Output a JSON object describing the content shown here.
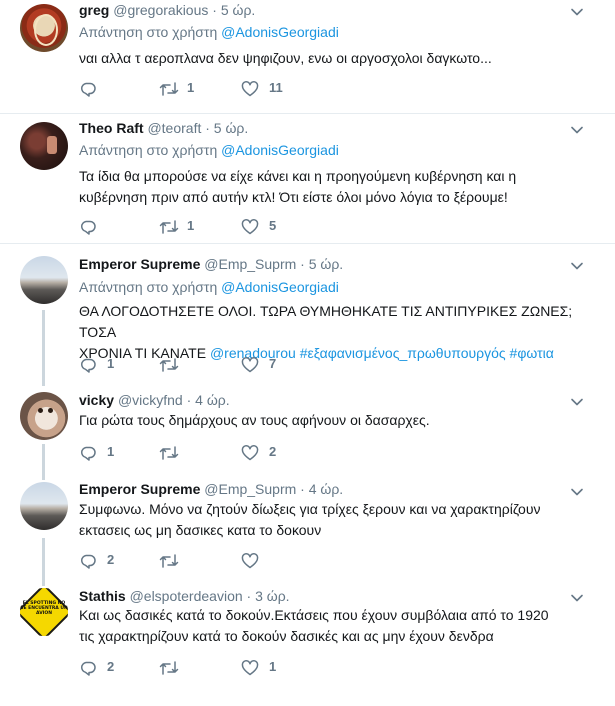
{
  "tweets": [
    {
      "name": "greg",
      "handle": "@gregorakious",
      "time": " · 5 ώρ.",
      "reply_prefix": "Απάντηση στο χρήστη ",
      "reply_mention": "@AdonisGeorgiadi",
      "text": "ναι αλλα τ αεροπλανα δεν ψηφιζουν, ενω οι αργοσχολοι δαγκωτο...",
      "replies": "",
      "retweets": "1",
      "likes": "11"
    },
    {
      "name": "Theo Raft",
      "handle": "@teoraft",
      "time": " · 5 ώρ.",
      "reply_prefix": "Απάντηση στο χρήστη ",
      "reply_mention": "@AdonisGeorgiadi",
      "text_lines": [
        "Τα ίδια θα μπορούσε να είχε κάνει και η προηγούμενη κυβέρνηση και η",
        "κυβέρνηση πριν από αυτήν κτλ! Ότι είστε όλοι μόνο λόγια το ξέρουμε!"
      ],
      "replies": "",
      "retweets": "1",
      "likes": "5"
    },
    {
      "name": "Emperor Supreme",
      "handle": "@Emp_Suprm",
      "time": " · 5 ώρ.",
      "reply_prefix": "Απάντηση στο χρήστη ",
      "reply_mention": "@AdonisGeorgiadi",
      "text_line1": "ΘΑ ΛΟΓΟΔΟΤΗΣΕΤΕ ΟΛΟΙ. ΤΩΡΑ ΘΥΜΗΘΗΚΑΤΕ ΤΙΣ ΑΝΤΙΠΥΡΙΚΕΣ ΖΩΝΕΣ; ΤΟΣΑ",
      "text_line2_prefix": "ΧΡΟΝΙΑ ΤΙ ΚΑΝΑΤΕ ",
      "text_line2_links": [
        "@renadourou",
        "#εξαφανισμένος_πρωθυπουργός",
        "#φωτια"
      ],
      "replies": "1",
      "retweets": "",
      "likes": "7"
    },
    {
      "name": "vicky",
      "handle": "@vickyfnd",
      "time": " · 4 ώρ.",
      "text": "Για ρώτα τους δημάρχους αν τους αφήνουν οι δασαρχες.",
      "replies": "1",
      "retweets": "",
      "likes": "2"
    },
    {
      "name": "Emperor Supreme",
      "handle": "@Emp_Suprm",
      "time": " · 4 ώρ.",
      "text_lines": [
        "Συμφωνω. Μόνο να ζητούν δίωξεις για τρίχες ξερουν και να χαρακτηρίζουν",
        "εκτασεις ως μη δασικες κατα το δοκουν"
      ],
      "replies": "2",
      "retweets": "",
      "likes": ""
    },
    {
      "name": "Stathis",
      "handle": "@elspoterdeavion",
      "time": " · 3 ώρ.",
      "avatar_sign_text": "EL SPOTTING NO SE ENCUENTRA UN AVION",
      "text_lines": [
        "Και ως δασικές κατά το δοκούν.Εκτάσεις που έχουν συμβόλαια από το 1920",
        "τις χαρακτηρίζουν κατά το δοκούν δασικές και ας μην έχουν δενδρα"
      ],
      "replies": "2",
      "retweets": "",
      "likes": "1"
    }
  ],
  "icons": {
    "reply": "reply-icon",
    "retweet": "retweet-icon",
    "like": "heart-icon",
    "more": "chevron-down-icon"
  },
  "colors": {
    "link": "#1b95e0",
    "secondary_text": "#657786",
    "primary_text": "#14171a",
    "divider": "#e6ecf0",
    "thread_line": "#ccd6dd"
  }
}
